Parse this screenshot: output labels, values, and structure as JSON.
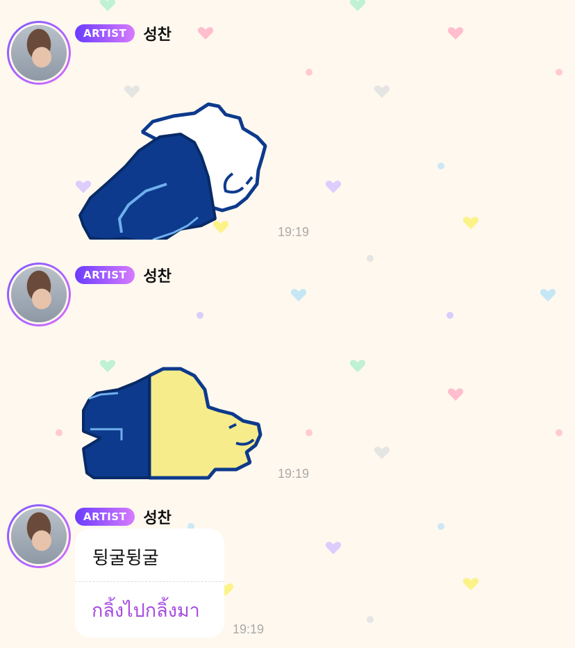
{
  "messages": [
    {
      "badge": "ARTIST",
      "sender": "성찬",
      "sticker": "sleeping-bear-white-sticker",
      "time": "19:19"
    },
    {
      "badge": "ARTIST",
      "sender": "성찬",
      "sticker": "sleeping-bear-yellow-sticker",
      "time": "19:19"
    },
    {
      "badge": "ARTIST",
      "sender": "성찬",
      "text": "뒹굴뒹굴",
      "translation": "กลิ้งไปกลิ้งมา",
      "time": "19:19"
    }
  ],
  "colors": {
    "background": "#fff8ee",
    "badge_start": "#6a3cff",
    "badge_end": "#d77bff",
    "translation": "#a64be0",
    "timestamp": "#a9a9a9",
    "sticker_navy": "#0d3a8c",
    "sticker_yellow": "#f7ec8c"
  }
}
